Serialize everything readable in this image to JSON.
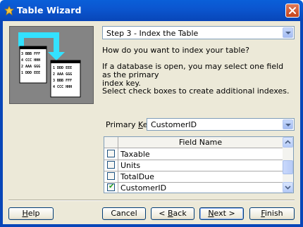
{
  "window": {
    "title": "Table Wizard"
  },
  "step_combo": {
    "value": "Step 3 - Index the Table"
  },
  "art": {
    "back_rows": [
      [
        "3",
        "BBB FFF"
      ],
      [
        "4",
        "CCC HHH"
      ],
      [
        "2",
        "AAA GGG"
      ],
      [
        "1",
        "DDD EEE"
      ]
    ],
    "front_rows": [
      [
        "1",
        "DDD EEE"
      ],
      [
        "2",
        "AAA GGG"
      ],
      [
        "3",
        "BBB FFF"
      ],
      [
        "4",
        "CCC HHH"
      ]
    ]
  },
  "text": {
    "question": "How do you want to index your table?",
    "primary_info_line1": "If a database is open, you may select one field as the primary",
    "primary_info_line2": "index key.",
    "checkbox_info": "Select check boxes to create additional indexes."
  },
  "primary_key": {
    "label_pre": "Primary ",
    "label_accel": "K",
    "label_post": "ey:",
    "value": "CustomerID"
  },
  "fields_grid": {
    "header": "Field Name",
    "rows": [
      {
        "name": "Taxable",
        "checked": false
      },
      {
        "name": "Units",
        "checked": false
      },
      {
        "name": "TotalDue",
        "checked": false
      },
      {
        "name": "CustomerID",
        "checked": true
      }
    ]
  },
  "buttons": {
    "help": {
      "pre": "",
      "accel": "H",
      "post": "elp"
    },
    "cancel": {
      "label": "Cancel"
    },
    "back": {
      "pre": "< ",
      "accel": "B",
      "post": "ack"
    },
    "next": {
      "pre": "",
      "accel": "N",
      "post": "ext >"
    },
    "finish": {
      "pre": "",
      "accel": "F",
      "post": "inish"
    }
  },
  "colors": {
    "titlebar": "#0a5fd8",
    "dialog_bg": "#ece9d8",
    "art_bg": "#848484",
    "arrow": "#33e1ff",
    "check": "#21a121"
  }
}
